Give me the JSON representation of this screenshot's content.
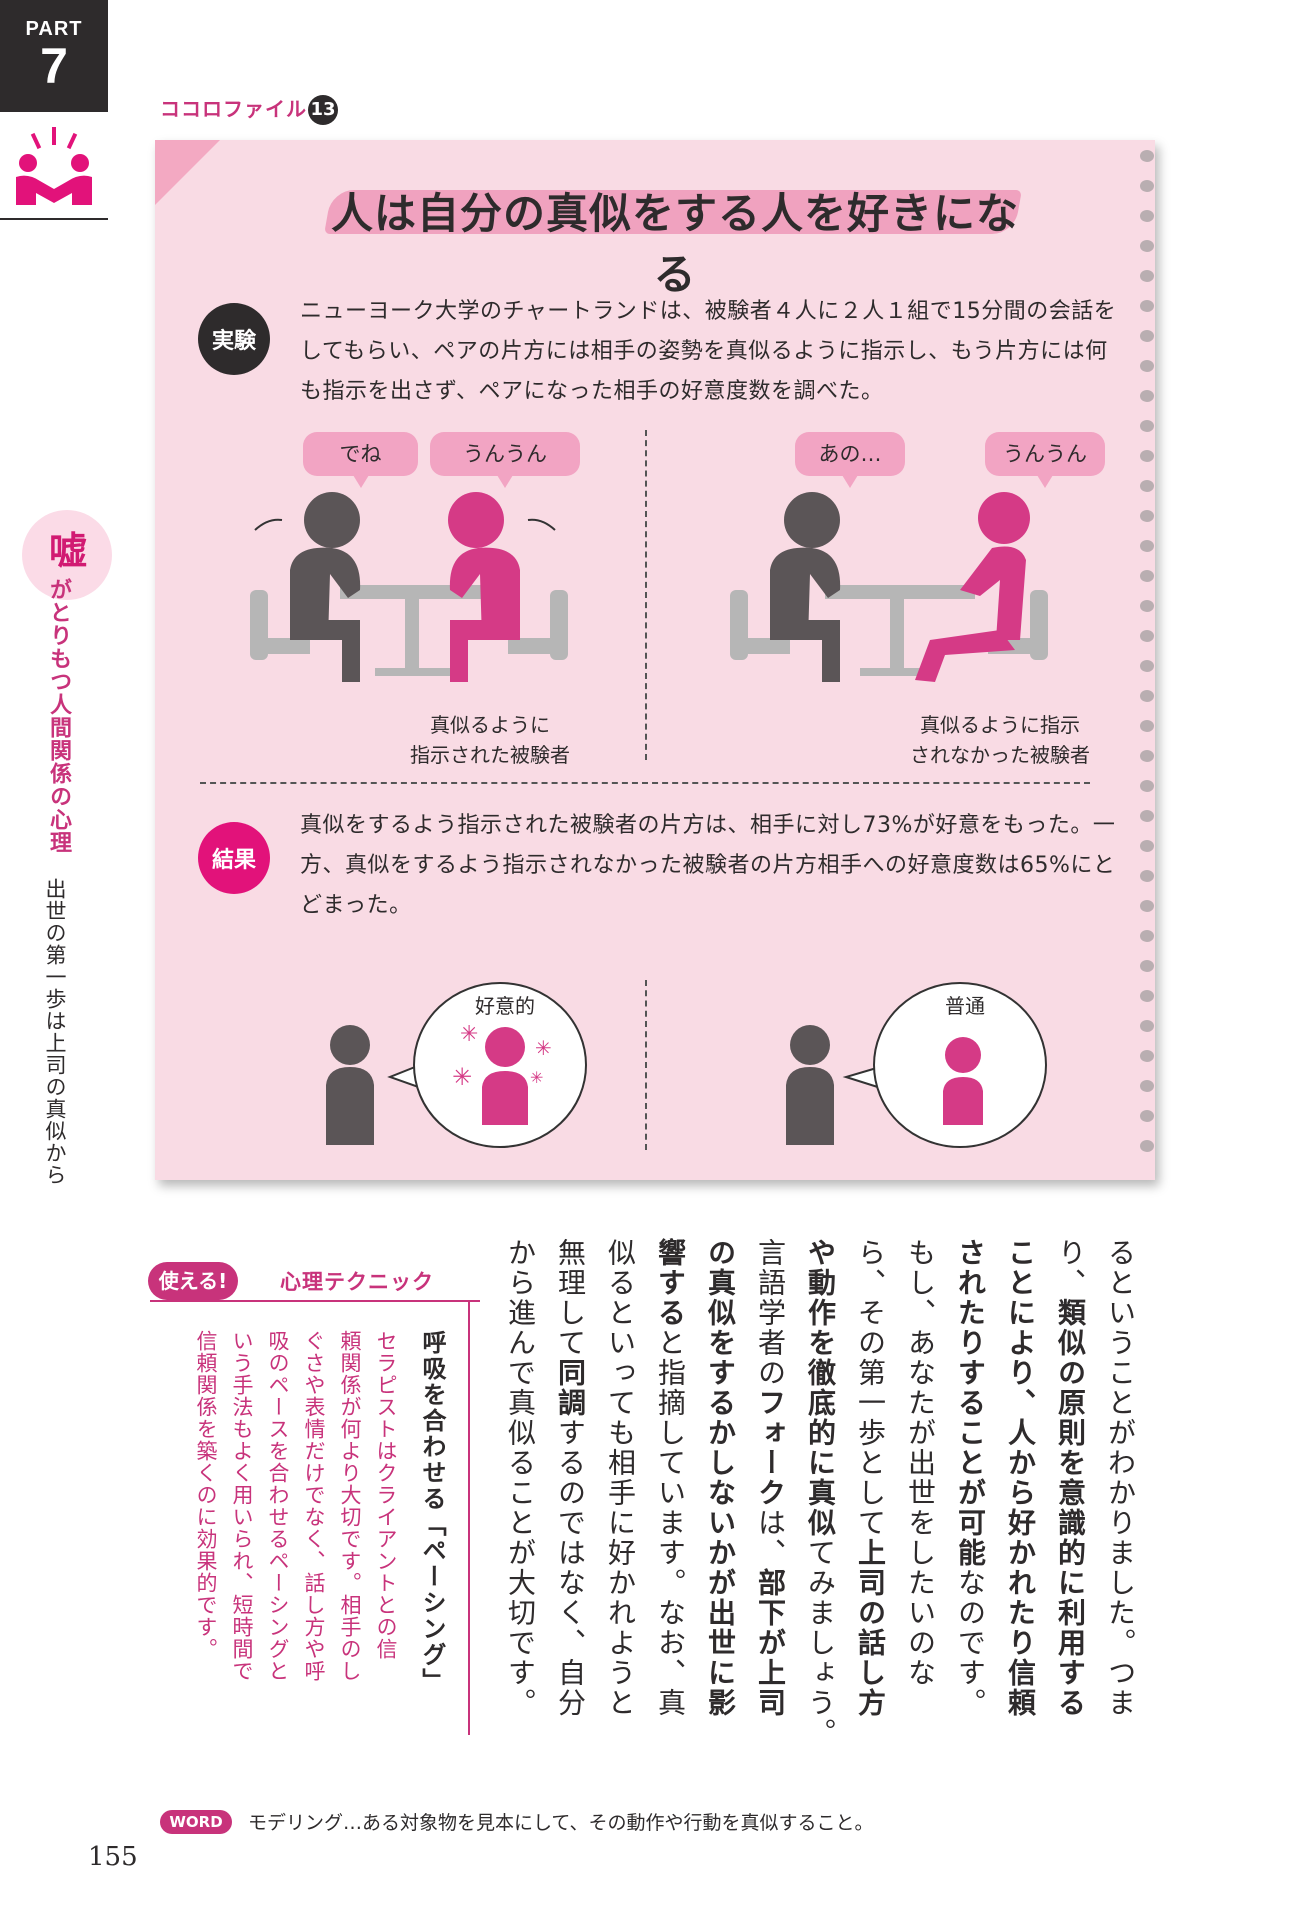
{
  "part": {
    "label": "PART",
    "number": "7"
  },
  "file": {
    "label": "ココロファイル",
    "number": "13"
  },
  "title": "人は自分の真似をする人を好きになる",
  "experiment": {
    "badge": "実験",
    "text": "ニューヨーク大学のチャートランドは、被験者４人に２人１組で15分間の会話をしてもらい、ペアの片方には相手の姿勢を真似るように指示し、もう片方には何も指示を出さず、ペアになった相手の好意度数を調べた。"
  },
  "scene_left": {
    "bubble1": "でね",
    "bubble2": "うんうん",
    "caption_line1": "真似るように",
    "caption_line2": "指示された被験者"
  },
  "scene_right": {
    "bubble1": "あの…",
    "bubble2": "うんうん",
    "caption_line1": "真似るように指示",
    "caption_line2": "されなかった被験者"
  },
  "result": {
    "badge": "結果",
    "text": "真似をするよう指示された被験者の片方は、相手に対し73%が好意をもった。一方、真似をするよう指示されなかった被験者の片方相手への好意度数は65%にとどまった。",
    "left_label": "好意的",
    "right_label": "普通"
  },
  "sidebar": {
    "kanji": "嘘",
    "subtitle": "がとりもつ人間関係の心理",
    "chapter": "出世の第一歩は上司の真似から"
  },
  "body": {
    "c1": "るということがわかりました。つま",
    "c2a": "り、",
    "c2b": "類似の原則を意識的に利用する",
    "c3": "ことにより、人から好かれたり信頼",
    "c4a": "されたりすることが可能",
    "c4b": "なのです。",
    "c5": "もし、あなたが出世をしたいのな",
    "c6a": "ら、その第一歩として",
    "c6b": "上司の話し方",
    "c7a": "や動作を徹底的に真似",
    "c7b": "てみましょう。",
    "c8a": "言語学者の",
    "c8b": "フォーク",
    "c8c": "は、",
    "c8d": "部下が上司",
    "c9": "の真似をするかしないかが出世に影",
    "c10a": "響する",
    "c10b": "と指摘しています。なお、真",
    "c11": "似るといっても相手に好かれようと",
    "c12a": "無理して",
    "c12b": "同調",
    "c12c": "するのではなく、自分",
    "c13": "から進んで真似ることが大切です。"
  },
  "technique": {
    "pill": "使える!",
    "label": "心理テクニック",
    "heading": "呼吸を合わせる「ペーシング」",
    "l1": "セラピストはクライアントとの信",
    "l2": "頼関係が何より大切です。相手のし",
    "l3": "ぐさや表情だけでなく、話し方や呼",
    "l4": "吸のペースを合わせるペーシングと",
    "l5": "いう手法もよく用いられ、短時間で",
    "l6": "信頼関係を築くのに効果的です。"
  },
  "word": {
    "tag": "WORD",
    "text": "モデリング…ある対象物を見本にして、その動作や行動を真似すること。"
  },
  "page_number": "155",
  "colors": {
    "pink": "#e2127a",
    "light_pink": "#f9dbe4",
    "dark": "#2e2b2c",
    "magenta_text": "#c8337b"
  }
}
